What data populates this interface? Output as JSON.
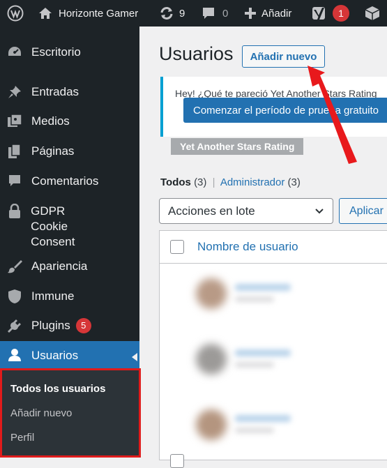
{
  "adminbar": {
    "site_name": "Horizonte Gamer",
    "updates_count": "9",
    "comments_count": "0",
    "add_label": "Añadir",
    "yoast_count": "1"
  },
  "sidebar": {
    "items": [
      {
        "label": "Escritorio",
        "icon": "dashboard-icon"
      },
      {
        "label": "Entradas",
        "icon": "pin-icon"
      },
      {
        "label": "Medios",
        "icon": "media-icon"
      },
      {
        "label": "Páginas",
        "icon": "pages-icon"
      },
      {
        "label": "Comentarios",
        "icon": "comment-icon"
      },
      {
        "label": "GDPR Cookie Consent",
        "icon": "lock-icon"
      },
      {
        "label": "Apariencia",
        "icon": "brush-icon"
      },
      {
        "label": "Immune",
        "icon": "shield-icon"
      },
      {
        "label": "Plugins",
        "icon": "plugin-icon",
        "badge": "5"
      },
      {
        "label": "Usuarios",
        "icon": "user-icon"
      }
    ],
    "submenu": {
      "all_users": "Todos los usuarios",
      "add_new": "Añadir nuevo",
      "profile": "Perfil"
    }
  },
  "page": {
    "title": "Usuarios",
    "add_new_button": "Añadir nuevo",
    "notice_text": "Hey! ¿Qué te pareció Yet Another Stars Rating",
    "notice_button": "Comenzar el período de prueba gratuito",
    "notice_tag": "Yet Another Stars Rating",
    "filter_all": "Todos",
    "filter_all_count": "(3)",
    "filter_separator": "|",
    "filter_admin": "Administrador",
    "filter_admin_count": "(3)",
    "bulk_actions": "Acciones en lote",
    "apply_button": "Aplicar",
    "column_username": "Nombre de usuario"
  },
  "colors": {
    "adminbar": "#1d2327",
    "accent": "#2271b1",
    "highlight_box": "#e01b1b",
    "badge": "#d63638"
  }
}
